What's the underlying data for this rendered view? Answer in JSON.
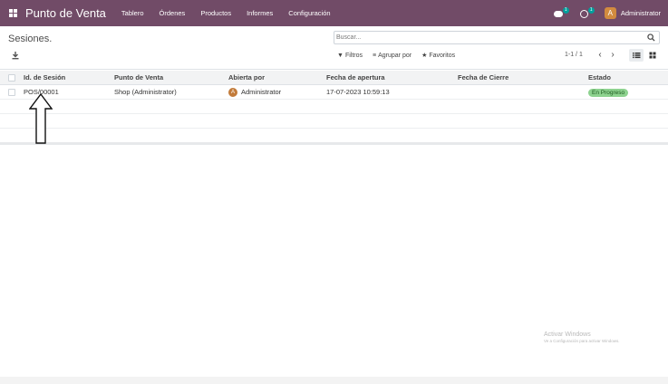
{
  "navbar": {
    "brand": "Punto de Venta",
    "menu": [
      "Tablero",
      "Órdenes",
      "Productos",
      "Informes",
      "Configuración"
    ],
    "chat_badge": "1",
    "activity_badge": "1",
    "user_initial": "A",
    "user_name": "Administrator",
    "color": "#714B67"
  },
  "control_panel": {
    "title": "Sesiones.",
    "search_placeholder": "Buscar...",
    "filters_label": "Filtros",
    "groupby_label": "Agrupar por",
    "favorites_label": "Favoritos",
    "pager": "1-1 / 1",
    "prev": "‹",
    "next": "›"
  },
  "table": {
    "columns": [
      "Id. de Sesión",
      "Punto de Venta",
      "Abierta por",
      "Fecha de apertura",
      "Fecha de Cierre",
      "Estado"
    ],
    "rows": [
      {
        "session_id": "POS/00001",
        "point_of_sale": "Shop (Administrator)",
        "opened_by_initial": "A",
        "opened_by": "Administrator",
        "opening_date": "17-07-2023 10:59:13",
        "closing_date": "",
        "status": "En Progreso"
      }
    ]
  },
  "watermark": {
    "title": "Activar Windows",
    "subtitle": "Ve a Configuración para activar Windows."
  },
  "icons": [
    "apps-grid-icon",
    "chat-icon",
    "clock-icon",
    "download-icon",
    "search-icon",
    "filter-icon",
    "groupby-icon",
    "star-icon",
    "list-view-icon",
    "kanban-view-icon",
    "up-arrow-annotation"
  ]
}
